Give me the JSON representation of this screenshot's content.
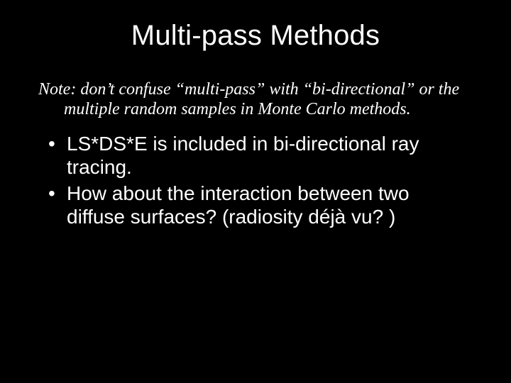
{
  "slide": {
    "title": "Multi-pass Methods",
    "note_line1": "Note: don’t confuse “multi-pass” with “bi-directional” or the",
    "note_line2": "multiple random samples in Monte Carlo methods.",
    "bullets": [
      "LS*DS*E is included in bi-directional ray tracing.",
      "How about the interaction between two diffuse surfaces?  (radiosity déjà vu? )"
    ]
  }
}
